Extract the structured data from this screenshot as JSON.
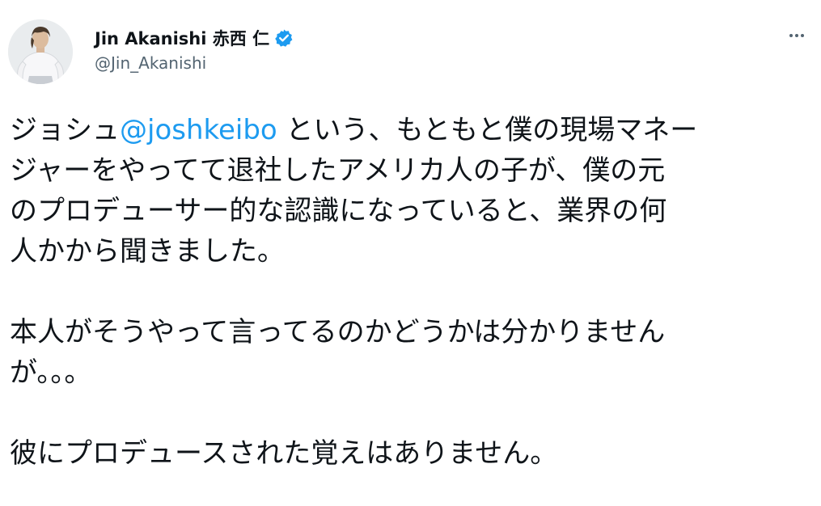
{
  "author": {
    "display_name": "Jin Akanishi 赤西 仁",
    "handle": "@Jin_Akanishi",
    "verified_icon": "verified-badge-icon",
    "avatar_icon": "avatar-photo",
    "more_icon": "more-options-icon"
  },
  "colors": {
    "accent": "#1d9bf0",
    "text": "#0f1419",
    "secondary": "#536471"
  },
  "tweet": {
    "p1": {
      "l1_pre": "ジョシュ",
      "l1_mention": "@joshkeibo",
      "l1_post": " という、もともと僕の現場マネー",
      "l2": "ジャーをやってて退社したアメリカ人の子が、僕の元",
      "l3": "のプロデューサー的な認識になっていると、業界の何",
      "l4": "人かから聞きました。"
    },
    "p2": {
      "l1": "本人がそうやって言ってるのかどうかは分かりません",
      "l2": "が。。。"
    },
    "p3": {
      "l1": "彼にプロデュースされた覚えはありません。"
    }
  }
}
